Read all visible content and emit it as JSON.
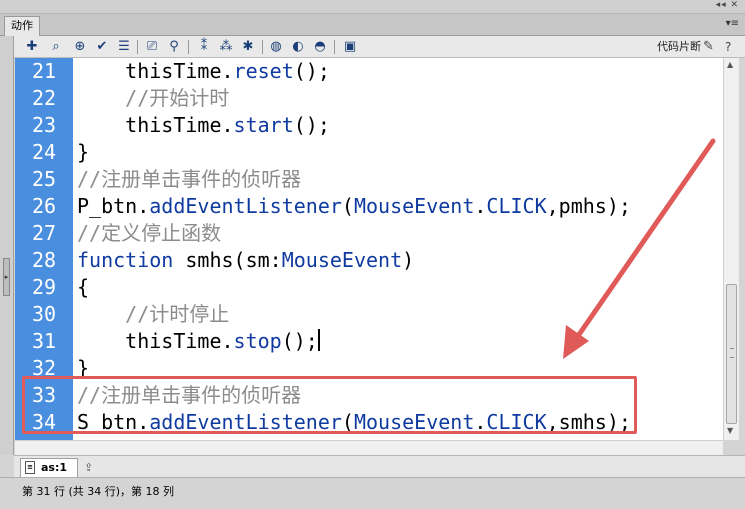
{
  "panel": {
    "tab_label": "动作",
    "window_controls": "◂◂ ✕",
    "menu_glyph": "▾≡"
  },
  "toolbar": {
    "code_snippets_label": "代码片断"
  },
  "editor": {
    "lines": [
      {
        "num": "21",
        "tokens": [
          {
            "t": "    thisTime.",
            "c": "plain"
          },
          {
            "t": "reset",
            "c": "method"
          },
          {
            "t": "();",
            "c": "plain"
          }
        ]
      },
      {
        "num": "22",
        "tokens": [
          {
            "t": "    //开始计时",
            "c": "comment"
          }
        ]
      },
      {
        "num": "23",
        "tokens": [
          {
            "t": "    thisTime.",
            "c": "plain"
          },
          {
            "t": "start",
            "c": "method"
          },
          {
            "t": "();",
            "c": "plain"
          }
        ]
      },
      {
        "num": "24",
        "tokens": [
          {
            "t": "}",
            "c": "plain"
          }
        ]
      },
      {
        "num": "25",
        "tokens": [
          {
            "t": "//注册单击事件的侦听器",
            "c": "comment"
          }
        ]
      },
      {
        "num": "26",
        "tokens": [
          {
            "t": "P_btn.",
            "c": "plain"
          },
          {
            "t": "addEventListener",
            "c": "method"
          },
          {
            "t": "(",
            "c": "plain"
          },
          {
            "t": "MouseEvent",
            "c": "class"
          },
          {
            "t": ".",
            "c": "plain"
          },
          {
            "t": "CLICK",
            "c": "class"
          },
          {
            "t": ",pmhs);",
            "c": "plain"
          }
        ]
      },
      {
        "num": "27",
        "tokens": [
          {
            "t": "//定义停止函数",
            "c": "comment"
          }
        ]
      },
      {
        "num": "28",
        "tokens": [
          {
            "t": "function",
            "c": "keyword"
          },
          {
            "t": " smhs(sm:",
            "c": "plain"
          },
          {
            "t": "MouseEvent",
            "c": "class"
          },
          {
            "t": ")",
            "c": "plain"
          }
        ]
      },
      {
        "num": "29",
        "tokens": [
          {
            "t": "{",
            "c": "plain"
          }
        ]
      },
      {
        "num": "30",
        "tokens": [
          {
            "t": "    //计时停止",
            "c": "comment"
          }
        ]
      },
      {
        "num": "31",
        "tokens": [
          {
            "t": "    thisTime.",
            "c": "plain"
          },
          {
            "t": "stop",
            "c": "method"
          },
          {
            "t": "();",
            "c": "plain"
          }
        ],
        "caret": true
      },
      {
        "num": "32",
        "tokens": [
          {
            "t": "}",
            "c": "plain"
          }
        ]
      },
      {
        "num": "33",
        "tokens": [
          {
            "t": "//注册单击事件的侦听器",
            "c": "comment"
          }
        ]
      },
      {
        "num": "34",
        "tokens": [
          {
            "t": "S_btn.",
            "c": "plain"
          },
          {
            "t": "addEventListener",
            "c": "method"
          },
          {
            "t": "(",
            "c": "plain"
          },
          {
            "t": "MouseEvent",
            "c": "class"
          },
          {
            "t": ".",
            "c": "plain"
          },
          {
            "t": "CLICK",
            "c": "class"
          },
          {
            "t": ",smhs);",
            "c": "plain"
          }
        ]
      }
    ]
  },
  "annotation": {
    "color": "#e05a5a"
  },
  "doc_tabs": {
    "active_label": "as:1"
  },
  "status": {
    "text": "第 31 行 (共 34 行)，第 18 列"
  }
}
